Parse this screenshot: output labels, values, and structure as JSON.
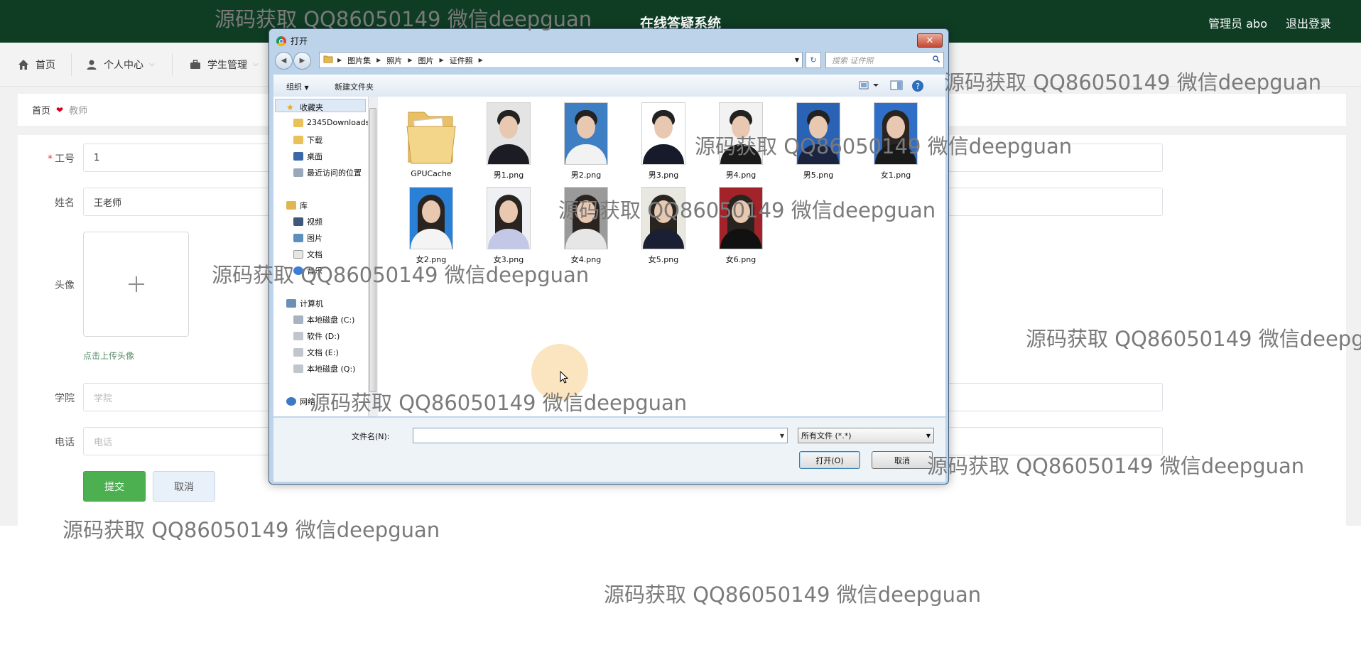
{
  "header": {
    "title": "在线答疑系统",
    "user": "管理员 abo",
    "logout": "退出登录"
  },
  "nav": {
    "items": [
      {
        "label": "首页"
      },
      {
        "label": "个人中心"
      },
      {
        "label": "学生管理"
      }
    ]
  },
  "breadcrumb": {
    "home": "首页",
    "current": "教师"
  },
  "form": {
    "id_label": "工号",
    "id_value": "1",
    "name_label": "姓名",
    "name_value": "王老师",
    "avatar_label": "头像",
    "upload_tip": "点击上传头像",
    "college_label": "学院",
    "college_placeholder": "学院",
    "phone_label": "电话",
    "phone_placeholder": "电话",
    "submit": "提交",
    "cancel": "取消"
  },
  "dialog": {
    "title": "打开",
    "path": [
      "图片集",
      "照片",
      "图片",
      "证件照"
    ],
    "search_placeholder": "搜索 证件照",
    "toolbar": {
      "organize": "组织",
      "new_folder": "新建文件夹"
    },
    "tree": {
      "favorites": "收藏夹",
      "favorites_items": [
        "2345Downloads",
        "下载",
        "桌面",
        "最近访问的位置"
      ],
      "library": "库",
      "library_items": [
        "视频",
        "图片",
        "文档",
        "音乐"
      ],
      "computer": "计算机",
      "computer_items": [
        "本地磁盘 (C:)",
        "软件 (D:)",
        "文档 (E:)",
        "本地磁盘 (Q:)"
      ],
      "network": "网络"
    },
    "files": [
      {
        "name": "GPUCache",
        "kind": "folder"
      },
      {
        "name": "男1.png",
        "kind": "male",
        "bg": "#e4e4e4",
        "suit": "#1c1c24"
      },
      {
        "name": "男2.png",
        "kind": "male",
        "bg": "#3e7fc4",
        "suit": "#f2f2f2"
      },
      {
        "name": "男3.png",
        "kind": "male",
        "bg": "#ffffff",
        "suit": "#161a2a"
      },
      {
        "name": "男4.png",
        "kind": "male",
        "bg": "#f2f2f2",
        "suit": "#1a1a1a"
      },
      {
        "name": "男5.png",
        "kind": "male",
        "bg": "#2a63b5",
        "suit": "#1a2440"
      },
      {
        "name": "女1.png",
        "kind": "female",
        "bg": "#2f6fc7",
        "suit": "#1a1a1a"
      },
      {
        "name": "女2.png",
        "kind": "female",
        "bg": "#2a7fd6",
        "suit": "#f4f4f4"
      },
      {
        "name": "女3.png",
        "kind": "female",
        "bg": "#eef0f4",
        "suit": "#c2c8e6"
      },
      {
        "name": "女4.png",
        "kind": "female",
        "bg": "#9a9a9a",
        "suit": "#e6e6e6"
      },
      {
        "name": "女5.png",
        "kind": "female",
        "bg": "#e8e8e0",
        "suit": "#1a1f33"
      },
      {
        "name": "女6.png",
        "kind": "female",
        "bg": "#a3232a",
        "suit": "#111111"
      }
    ],
    "filename_label": "文件名(N):",
    "filetype": "所有文件 (*.*)",
    "open": "打开(O)",
    "cancel": "取消"
  },
  "watermark": "源码获取 QQ86050149 微信deepguan",
  "colors": {
    "topbar": "#0f3d24",
    "submit": "#4caf50",
    "required": "#e0393e",
    "heart": "#d0021b"
  }
}
